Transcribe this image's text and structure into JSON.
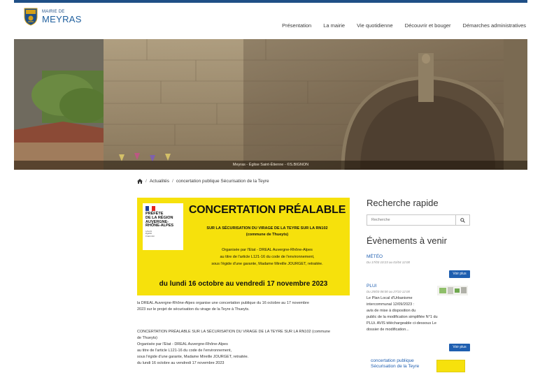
{
  "header": {
    "logo_small": "MAIRIE DE",
    "logo_big": "MEYRAS",
    "nav": [
      "Présentation",
      "La mairie",
      "Vie quotidienne",
      "Découvrir et bouger",
      "Démarches administratives"
    ]
  },
  "hero": {
    "caption": "Meyras - Église Saint-Étienne - ©S.BIGNON"
  },
  "breadcrumb": {
    "items": [
      "Actualités",
      "concertation publique Sécurisation de la Teyre"
    ],
    "separator": "/"
  },
  "poster": {
    "prefecture": [
      "PRÉFÈTE",
      "DE LA RÉGION",
      "AUVERGNE-",
      "RHÔNE-ALPES"
    ],
    "motto": [
      "Liberté",
      "Égalité",
      "Fraternité"
    ],
    "title": "CONCERTATION PRÉALABLE",
    "subtitle_1": "SUR LA SÉCURISATION DU VIRAGE DE LA TEYRE SUR LA RN102",
    "subtitle_2": "(commune de Thueyts)",
    "body": [
      "Organisée par l'Etat - DREAL Auvergne-Rhône-Alpes",
      "au titre de l'article L121-16 du code de l'environnement,",
      "sous l'égide d'une garante, Madame Mireille JOURGET, retraitée."
    ],
    "dates": "du lundi 16 octobre au vendredi 17 novembre 2023"
  },
  "article": {
    "p1_lines": [
      "la DREAL Auvergne-Rhône-Alpes organise une concertation publique du 16 octobre au 17 novembre",
      "2023 sur le projet de sécurisation du virage de la Teyre à Thueyts."
    ],
    "p2_lines": [
      "CONCERTATION PRÉALABLE SUR LA SÉCURISATION DU VIRAGE DE LA TEYRE SUR LA RN102 (commune",
      "de Thueyts)",
      "Organisée par l'Etat - DREAL Auvergne-Rhône-Alpes",
      "au titre de l'article L121-16 du code de l'environnement,",
      "sous l'égide d'une garante, Madame Mireille JOURGET, retraitée.",
      "du lundi 16 octobre au vendredi 17 novembre 2023"
    ]
  },
  "sidebar": {
    "search_title": "Recherche rapide",
    "search_placeholder": "Recherche",
    "events_title": "Évènements à venir",
    "events": [
      {
        "title": "MÉTÉO",
        "date": "Du 17/03 10:23 au 01/04 12:00"
      },
      {
        "title": "PLUI",
        "date": "Du 25/03 08:00 au 27/10 12:00",
        "lines": [
          "Le Plan Local d'Urbanisme",
          "intercommunal 12/09/2023 :",
          "avis de mise à disposition du",
          "public de la modification simplifiée N°1 du",
          "PLUi. AVIS téléchargeable ci-dessous Le",
          "dossier de modification..."
        ]
      },
      {
        "title": "concertation publique Sécurisation de la Teyre"
      }
    ],
    "voir_plus": "Voir plus"
  },
  "colors": {
    "brand_blue": "#1f4f86",
    "link_blue": "#1f5fb0",
    "poster_yellow": "#f6e10c"
  }
}
